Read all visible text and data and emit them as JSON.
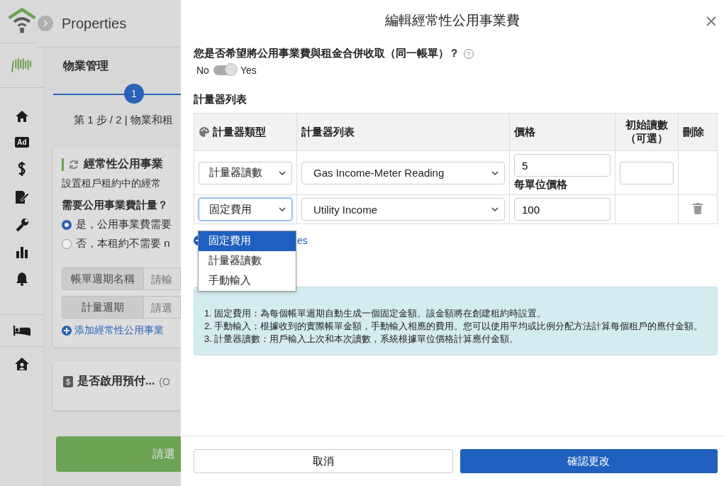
{
  "background": {
    "header_title": "Properties",
    "ad_badge": "Ad",
    "money_badge": "$",
    "section_title": "物業管理",
    "step_number": "1",
    "step_label": "第 1 步 / 2 | 物業和租",
    "card": {
      "title": "經常性公用事業",
      "description": "設置租戶租約中的經常",
      "question": "需要公用事業費計量？",
      "options": [
        {
          "label": "是，公用事業費需要",
          "selected": true
        },
        {
          "label": "否，本租約不需要 n",
          "selected": false
        }
      ],
      "fields": [
        {
          "label": "帳單週期名稱",
          "placeholder": "請輸"
        },
        {
          "label": "計量週期",
          "placeholder": "請選"
        }
      ],
      "add_link": "添加經常性公用事業"
    },
    "card2": {
      "title": "是否啟用預付...",
      "note": "(O"
    },
    "primary_button": "請選"
  },
  "modal": {
    "title": "編輯經常性公用事業費",
    "question": "您是否希望將公用事業費與租金合併收取（同一帳單）？",
    "help_mark": "?",
    "toggle": {
      "off_label": "No",
      "on_label": "Yes",
      "on": true
    },
    "table_title": "計量器列表",
    "columns": [
      "計量器類型",
      "計量器列表",
      "價格",
      "初始讀數（可選）",
      "刪除"
    ],
    "rows": [
      {
        "kind": "meter",
        "type": "計量器讀數",
        "meter": "Gas Income-Meter Reading",
        "price": "5",
        "price_note": "每單位價格"
      },
      {
        "kind": "fixed",
        "type": "固定費用",
        "meter": "Utility Income",
        "price": "100"
      }
    ],
    "dropdown": [
      {
        "label": "固定費用",
        "selected": true
      },
      {
        "label": "計量器讀數",
        "selected": false
      },
      {
        "label": "手動輸入",
        "selected": false
      }
    ],
    "add_link": "es",
    "info": [
      "1. 固定費用：為每個帳單週期自動生成一個固定金額。該金額將在創建租約時設置。",
      "2. 手動輸入：根據收到的實際帳單金額，手動輸入相應的費用。您可以使用平均或比例分配方法計算每個租戶的應付金額。",
      "3. 計量器讀數：用戶輸入上次和本次讀數，系統根據單位價格計算應付金額。"
    ],
    "cancel": "取消",
    "confirm": "確認更改"
  }
}
